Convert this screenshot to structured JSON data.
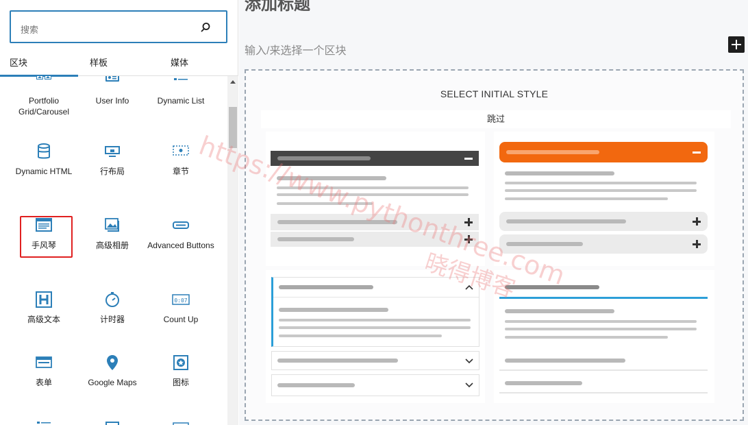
{
  "search": {
    "placeholder": "搜索"
  },
  "tabs": [
    "区块",
    "样板",
    "媒体"
  ],
  "blocks": [
    {
      "label": "Portfolio Grid/Carousel",
      "icon": "gallery-icon"
    },
    {
      "label": "User Info",
      "icon": "user-info-icon"
    },
    {
      "label": "Dynamic List",
      "icon": "list-icon"
    },
    {
      "label": "Dynamic HTML",
      "icon": "database-icon"
    },
    {
      "label": "行布局",
      "icon": "row-layout-icon"
    },
    {
      "label": "章节",
      "icon": "section-icon"
    },
    {
      "label": "手风琴",
      "icon": "accordion-icon"
    },
    {
      "label": "高级相册",
      "icon": "image-gallery-icon"
    },
    {
      "label": "Advanced Buttons",
      "icon": "button-icon"
    },
    {
      "label": "高级文本",
      "icon": "heading-icon"
    },
    {
      "label": "计时器",
      "icon": "timer-icon"
    },
    {
      "label": "Count Up",
      "icon": "counter-icon"
    },
    {
      "label": "表单",
      "icon": "form-icon"
    },
    {
      "label": "Google Maps",
      "icon": "map-pin-icon"
    },
    {
      "label": "图标",
      "icon": "icon-block-icon"
    }
  ],
  "editor": {
    "title": "添加标题",
    "prompt": "输入/来选择一个区块",
    "select_title": "SELECT INITIAL STYLE",
    "skip": "跳过"
  },
  "colors": {
    "accent": "#2c7fb8",
    "orange": "#f2680f",
    "dark": "#444444",
    "highlight": "#e02020"
  },
  "watermark": {
    "url": "https://www.pythonthree.com",
    "name": "晓得博客"
  }
}
